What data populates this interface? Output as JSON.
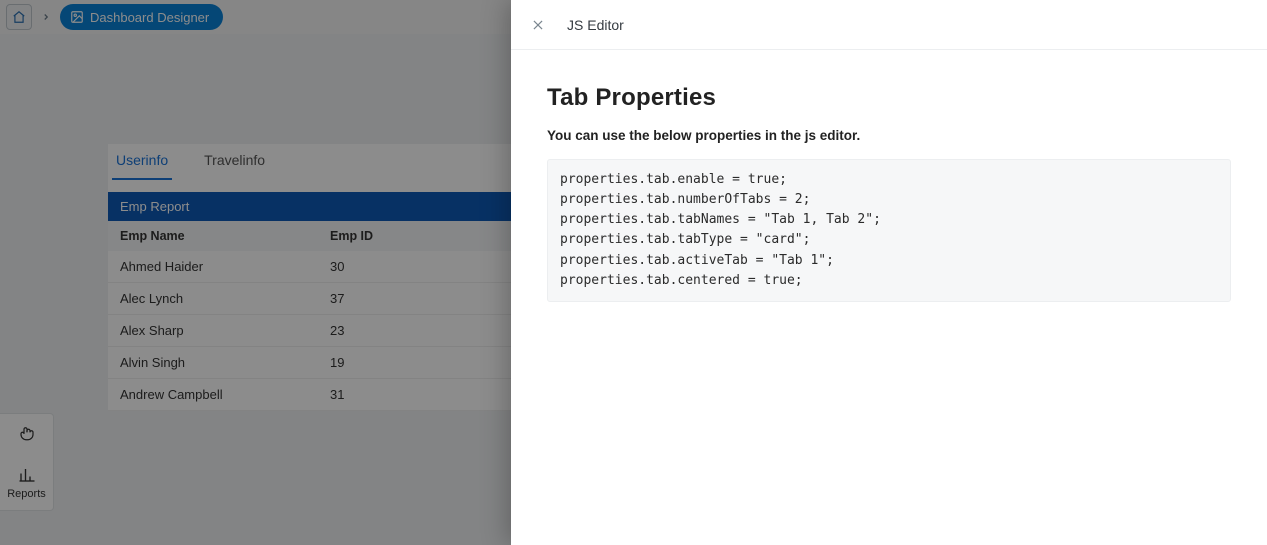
{
  "breadcrumb": {
    "label": "Dashboard Designer"
  },
  "panel": {
    "tabs": [
      {
        "label": "Userinfo",
        "active": true
      },
      {
        "label": "Travelinfo",
        "active": false
      }
    ],
    "report_title": "Emp Report",
    "columns": {
      "name": "Emp Name",
      "id": "Emp ID"
    },
    "rows": [
      {
        "name": "Ahmed Haider",
        "id": "30"
      },
      {
        "name": "Alec Lynch",
        "id": "37"
      },
      {
        "name": "Alex Sharp",
        "id": "23"
      },
      {
        "name": "Alvin Singh",
        "id": "19"
      },
      {
        "name": "Andrew Campbell",
        "id": "31"
      }
    ]
  },
  "dock": {
    "item1": {
      "label": ""
    },
    "item2": {
      "label": "Reports"
    }
  },
  "drawer": {
    "title": "JS Editor",
    "heading": "Tab Properties",
    "subheading": "You can use the below properties in the js editor.",
    "code": "properties.tab.enable = true;\nproperties.tab.numberOfTabs = 2;\nproperties.tab.tabNames = \"Tab 1, Tab 2\";\nproperties.tab.tabType = \"card\";\nproperties.tab.activeTab = \"Tab 1\";\nproperties.tab.centered = true;"
  }
}
